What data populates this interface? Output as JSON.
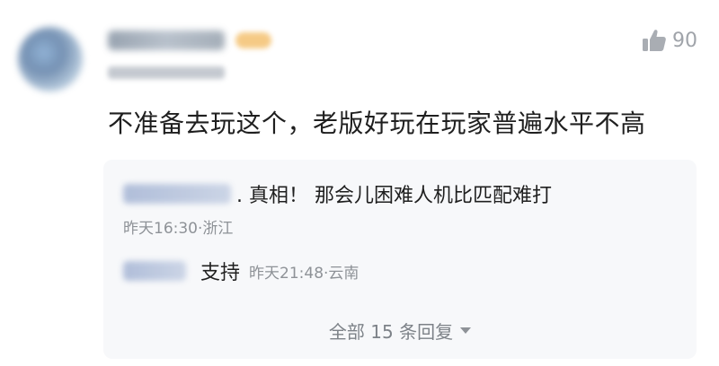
{
  "comment": {
    "like_count": "90",
    "like_icon": "thumbs-up-icon",
    "text": "不准备去玩这个，老版好玩在玩家普遍水平不高"
  },
  "replies": [
    {
      "text": ". 真相！ 那会儿困难人机比匹配难打",
      "meta": "昨天16:30·浙江"
    },
    {
      "text": "支持",
      "meta": "昨天21:48·云南"
    }
  ],
  "all_replies_label": "全部 15 条回复",
  "colors": {
    "reply_background": "#f7f8fa",
    "meta_text": "#8e9297",
    "badge": "#f4c170"
  }
}
